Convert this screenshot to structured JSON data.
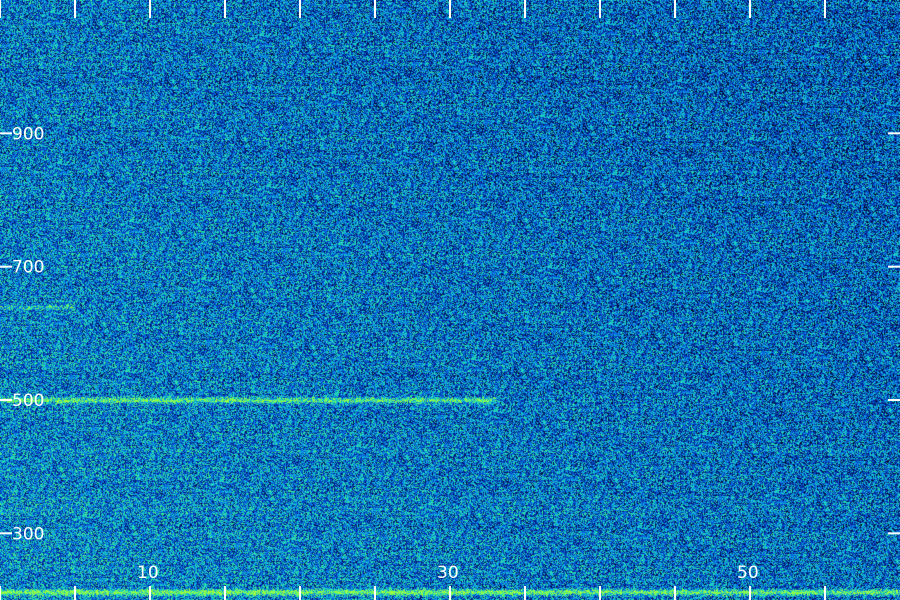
{
  "chart_data": {
    "type": "heatmap",
    "title": "",
    "xlabel": "",
    "ylabel": "",
    "xlim": [
      0,
      60
    ],
    "ylim": [
      200,
      1100
    ],
    "x_ticks": [
      0,
      5,
      10,
      15,
      20,
      25,
      30,
      35,
      40,
      45,
      50,
      55
    ],
    "x_tick_labels": [
      "10",
      "30",
      "50"
    ],
    "x_tick_label_values": [
      10,
      30,
      50
    ],
    "y_ticks": [
      300,
      500,
      700,
      900
    ],
    "y_tick_labels": [
      "300",
      "500",
      "700",
      "900"
    ],
    "colormap": [
      "#000000",
      "#001a80",
      "#0046c8",
      "#0a82e6",
      "#14c8d2",
      "#3cf08c",
      "#a0ff3c"
    ],
    "noise_floor_level": 0.45,
    "features": [
      {
        "kind": "horizontal-band",
        "y": 500,
        "x_range": [
          0,
          33
        ],
        "intensity": 0.55
      },
      {
        "kind": "horizontal-band",
        "y": 212,
        "x_range": [
          0,
          60
        ],
        "intensity": 0.7
      },
      {
        "kind": "horizontal-band",
        "y": 640,
        "x_range": [
          0,
          5
        ],
        "intensity": 0.3
      }
    ],
    "grid": false,
    "legend": "none"
  }
}
